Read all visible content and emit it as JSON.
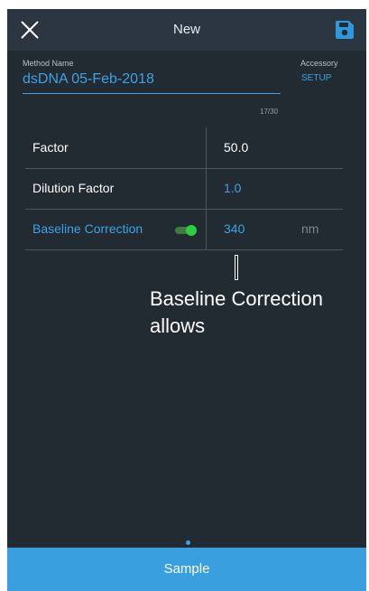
{
  "appbar": {
    "title": "New",
    "close_icon": "close-icon",
    "save_icon": "save-icon"
  },
  "method": {
    "label": "Method Name",
    "value": "dsDNA 05-Feb-2018",
    "counter": "17/30"
  },
  "accessory": {
    "label": "Accessory",
    "link": "SETUP"
  },
  "rows": [
    {
      "label": "Factor",
      "value": "50.0",
      "unit": ""
    },
    {
      "label": "Dilution Factor",
      "value": "1.0",
      "unit": ""
    },
    {
      "label": "Baseline Correction",
      "value": "340",
      "unit": "nm",
      "toggle_on": true
    }
  ],
  "overlay": {
    "line1": "Baseline Correction",
    "line2": "allows"
  },
  "footer": {
    "button_label": "Sample"
  },
  "colors": {
    "accent": "#3ba3e6",
    "background": "#222a32",
    "appbar": "#2c3640",
    "toggle_on": "#2ecc40",
    "button": "#3a9fdf"
  }
}
